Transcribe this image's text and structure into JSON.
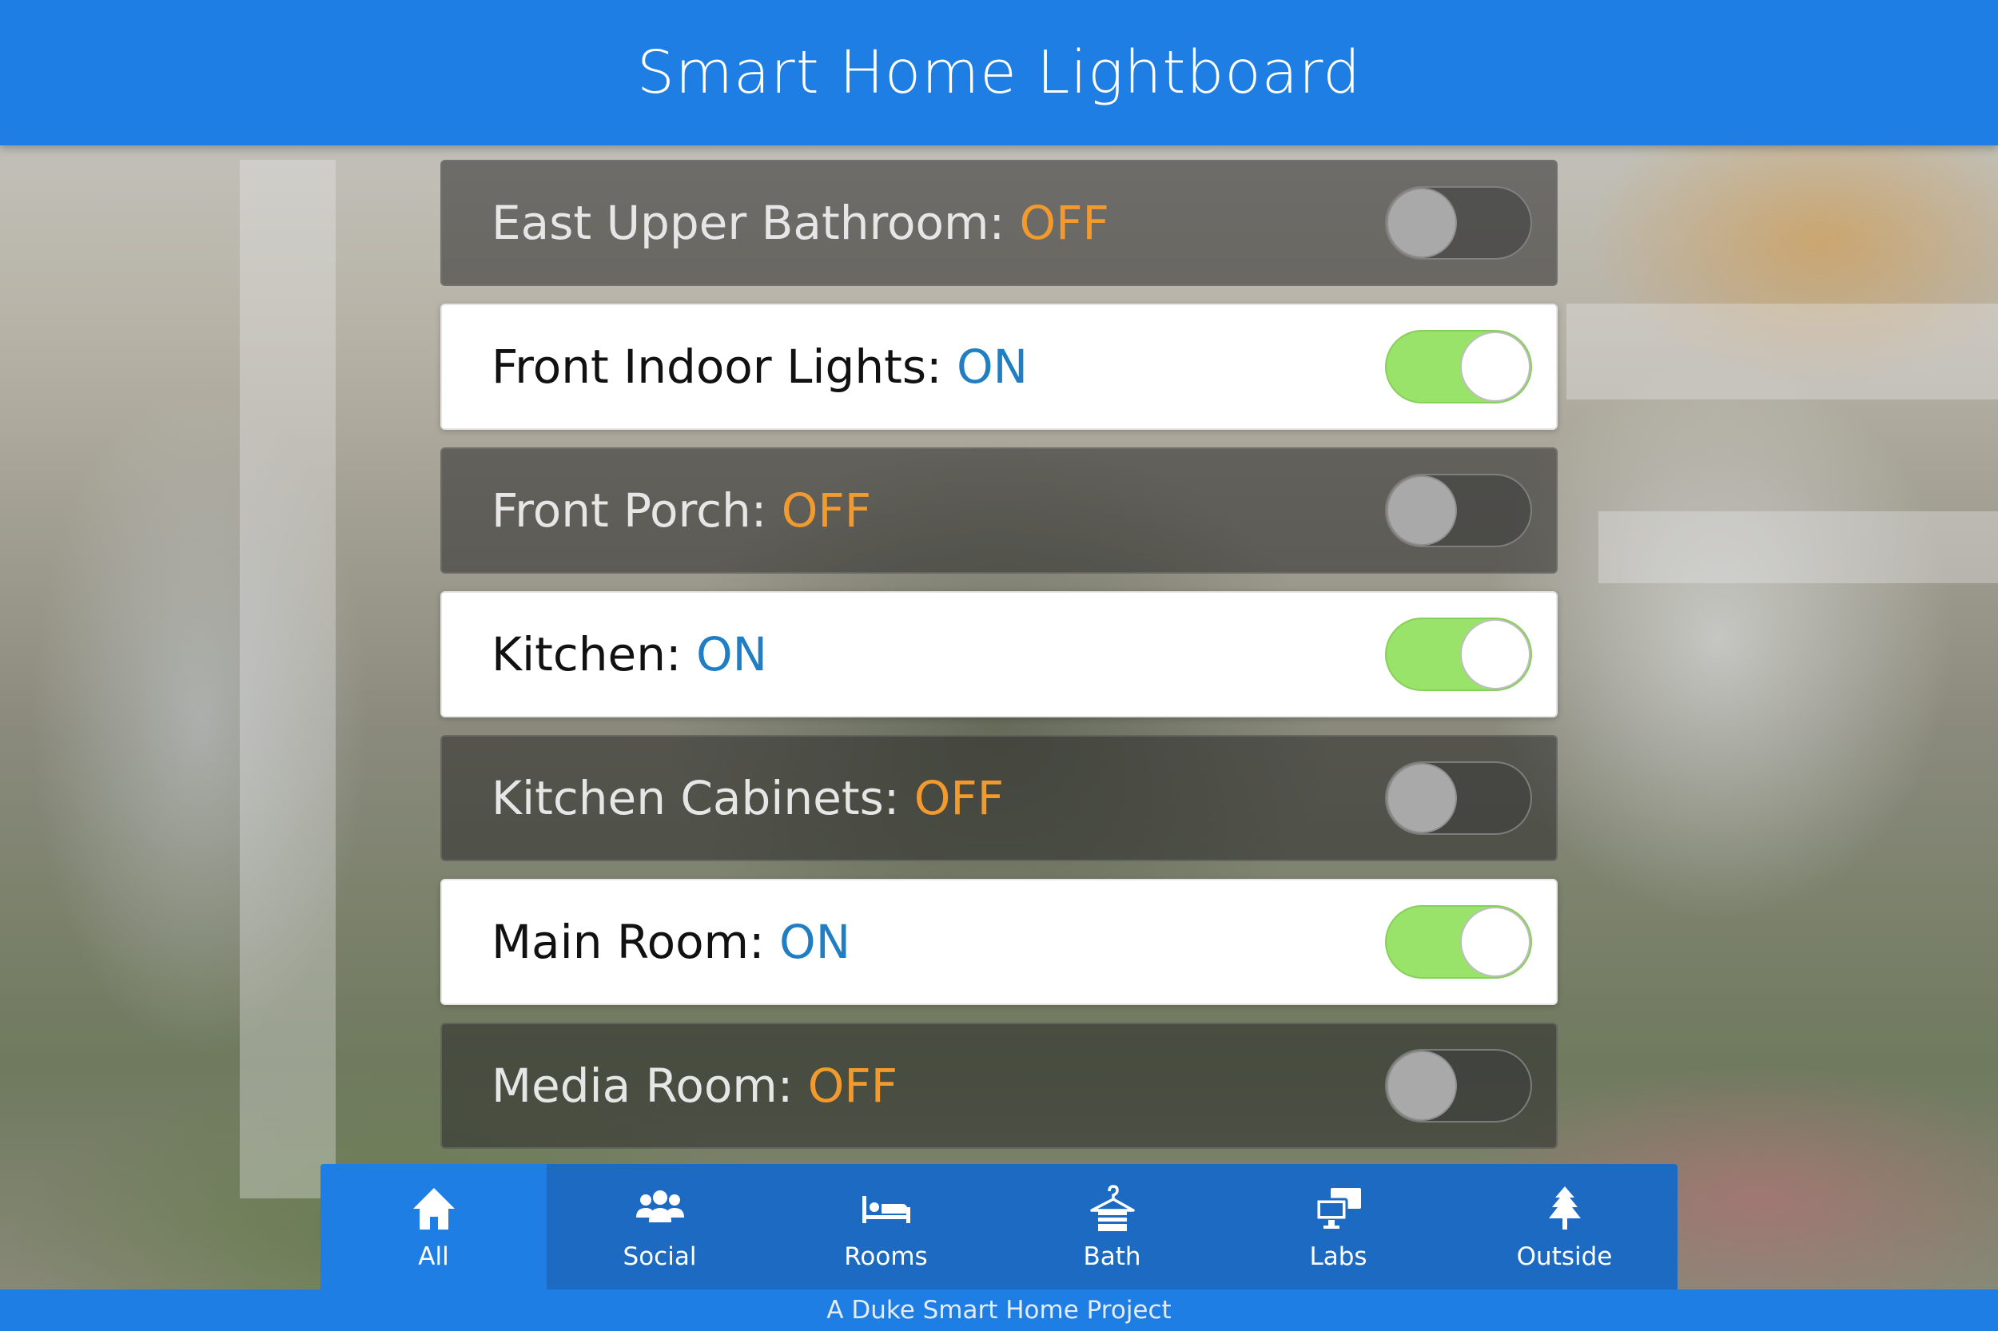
{
  "header": {
    "title": "Smart Home Lightboard"
  },
  "lights": [
    {
      "name": "East Upper Bathroom:",
      "state": "OFF",
      "on": false
    },
    {
      "name": "Front Indoor Lights:",
      "state": "ON",
      "on": true
    },
    {
      "name": "Front Porch:",
      "state": "OFF",
      "on": false
    },
    {
      "name": "Kitchen:",
      "state": "ON",
      "on": true
    },
    {
      "name": "Kitchen Cabinets:",
      "state": "OFF",
      "on": false
    },
    {
      "name": "Main Room:",
      "state": "ON",
      "on": true
    },
    {
      "name": "Media Room:",
      "state": "OFF",
      "on": false
    }
  ],
  "tabs": [
    {
      "label": "All",
      "icon": "home-icon",
      "active": true
    },
    {
      "label": "Social",
      "icon": "people-icon",
      "active": false
    },
    {
      "label": "Rooms",
      "icon": "bed-icon",
      "active": false
    },
    {
      "label": "Bath",
      "icon": "hanger-icon",
      "active": false
    },
    {
      "label": "Labs",
      "icon": "computers-icon",
      "active": false
    },
    {
      "label": "Outside",
      "icon": "tree-icon",
      "active": false
    }
  ],
  "footer": {
    "text": "A Duke Smart Home Project"
  },
  "colors": {
    "header": "#1f7ee3",
    "tabbar": "#1d6ac3",
    "on_state": "#1f7ec4",
    "off_state": "#f29a2e",
    "toggle_on": "#9ae36a"
  }
}
